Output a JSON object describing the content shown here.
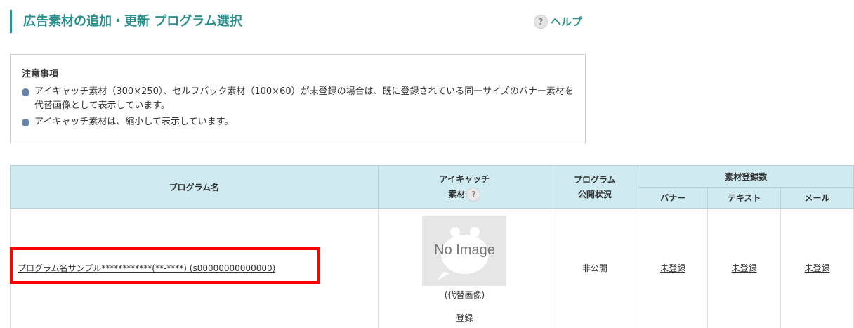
{
  "page": {
    "title": "広告素材の追加・更新 プログラム選択",
    "help_label": "ヘルプ",
    "help_icon": "?"
  },
  "notice": {
    "heading": "注意事項",
    "items": [
      "アイキャッチ素材（300×250）、セルフバック素材（100×60）が未登録の場合は、既に登録されている同一サイズのバナー素材を代替画像として表示しています。",
      "アイキャッチ素材は、縮小して表示しています。"
    ]
  },
  "table": {
    "headers": {
      "program_name": "プログラム名",
      "eyecatch_line1": "アイキャッチ",
      "eyecatch_line2": "素材",
      "status_line1": "プログラム",
      "status_line2": "公開状況",
      "material_count": "素材登録数",
      "banner": "バナー",
      "text": "テキスト",
      "mail": "メール"
    },
    "rows": [
      {
        "program_name": "プログラム名サンプル************(**-****) (s00000000000000)",
        "image_placeholder": "No Image",
        "image_caption": "(代替画像)",
        "register_link": "登録",
        "status": "非公開",
        "banner": "未登録",
        "text": "未登録",
        "mail": "未登録"
      }
    ]
  },
  "colors": {
    "accent": "#2b8f8d",
    "header_bg": "#cfeaf0",
    "highlight": "#ff0000"
  }
}
